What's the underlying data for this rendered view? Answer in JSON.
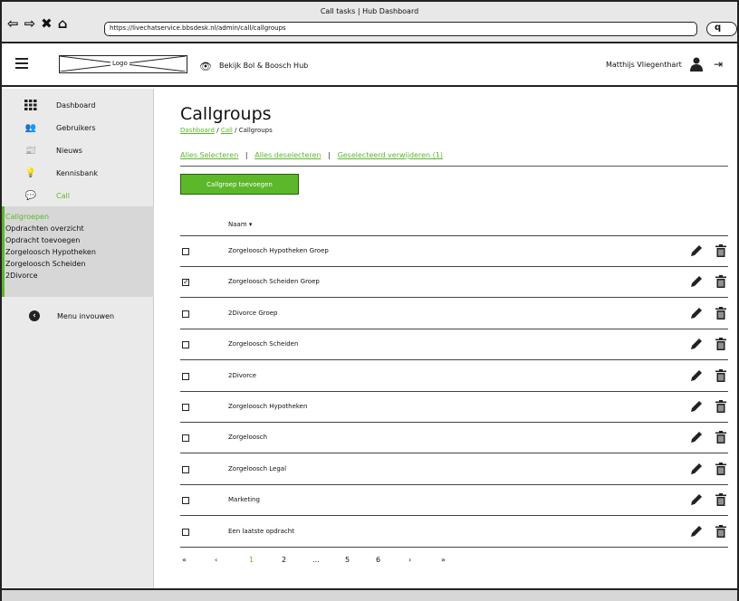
{
  "browser": {
    "window_title": "Call tasks | Hub Dashboard",
    "url": "https://livechatservice.bbsdesk.nl/admin/call/callgroups",
    "search_placeholder": "q"
  },
  "header": {
    "logo_text": "Logo",
    "hub_link": "Bekijk Bol & Boosch Hub",
    "user_name": "Matthijs Vliegenthart"
  },
  "sidebar": {
    "items": [
      {
        "label": "Dashboard",
        "icon": "grid-icon"
      },
      {
        "label": "Gebruikers",
        "icon": "users-icon"
      },
      {
        "label": "Nieuws",
        "icon": "news-icon"
      },
      {
        "label": "Kennisbank",
        "icon": "lightbulb-icon"
      },
      {
        "label": "Call",
        "icon": "chat-icon"
      }
    ],
    "submenu": [
      "Callgroepen",
      "Opdrachten overzicht",
      "Opdracht toevoegen",
      "Zorgeloosch Hypotheken",
      "Zorgeloosch Scheiden",
      "2Divorce"
    ],
    "collapse_label": "Menu invouwen"
  },
  "main": {
    "title": "Callgroups",
    "breadcrumb": [
      "Dashboard",
      "Call",
      "Callgroups"
    ],
    "actions": {
      "select_all": "Alles Selecteren",
      "deselect_all": "Alles deselecteren",
      "delete_selected": "Geselecteerd verwijderen (1)"
    },
    "add_button": "Callgroep toevoegen",
    "column_header": "Naam",
    "rows": [
      {
        "name": "Zorgeloosch Hypotheken Groep",
        "checked": false
      },
      {
        "name": "Zorgeloosch Scheiden Groep",
        "checked": true
      },
      {
        "name": "2Divorce Groep",
        "checked": false
      },
      {
        "name": "Zorgeloosch Scheiden",
        "checked": false
      },
      {
        "name": "2Divorce",
        "checked": false
      },
      {
        "name": "Zorgeloosch Hypotheken",
        "checked": false
      },
      {
        "name": "Zorgeloosch",
        "checked": false
      },
      {
        "name": "Zorgeloosch Legal",
        "checked": false
      },
      {
        "name": "Marketing",
        "checked": false
      },
      {
        "name": "Een laatste opdracht",
        "checked": false
      }
    ],
    "pagination": [
      "«",
      "‹",
      "1",
      "2",
      "...",
      "5",
      "6",
      "›",
      "»"
    ],
    "current_page": "1"
  },
  "colors": {
    "accent": "#5cb82a",
    "sidebar_bg": "#eaeaea",
    "submenu_bg": "#d7d7d7"
  }
}
